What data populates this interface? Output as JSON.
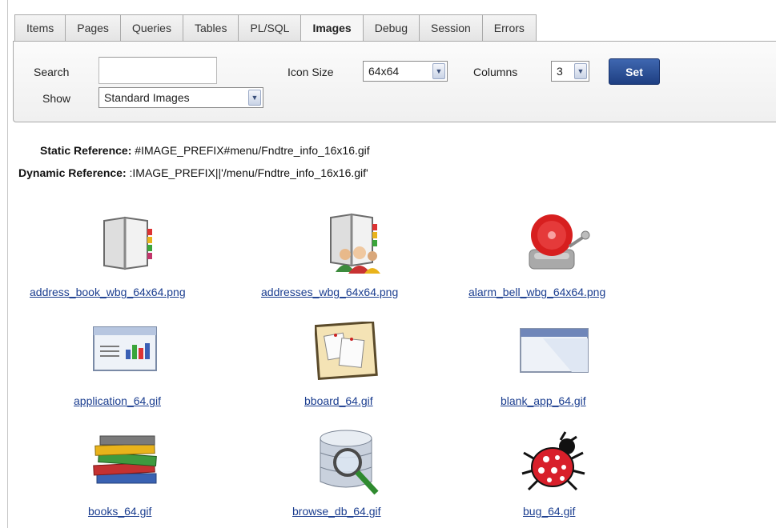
{
  "tabs": [
    {
      "label": "Items"
    },
    {
      "label": "Pages"
    },
    {
      "label": "Queries"
    },
    {
      "label": "Tables"
    },
    {
      "label": "PL/SQL"
    },
    {
      "label": "Images",
      "active": true
    },
    {
      "label": "Debug"
    },
    {
      "label": "Session"
    },
    {
      "label": "Errors"
    }
  ],
  "filters": {
    "search_label": "Search",
    "search_value": "",
    "show_label": "Show",
    "show_value": "Standard Images",
    "icon_size_label": "Icon Size",
    "icon_size_value": "64x64",
    "columns_label": "Columns",
    "columns_value": "3",
    "set_label": "Set"
  },
  "reference": {
    "static_label": "Static Reference:",
    "static_value": "#IMAGE_PREFIX#menu/Fndtre_info_16x16.gif",
    "dynamic_label": "Dynamic Reference:",
    "dynamic_value": ":IMAGE_PREFIX||'/menu/Fndtre_info_16x16.gif'"
  },
  "images": [
    {
      "name": "address_book_wbg_64x64.png",
      "icon": "address-book-icon"
    },
    {
      "name": "addresses_wbg_64x64.png",
      "icon": "addresses-icon"
    },
    {
      "name": "alarm_bell_wbg_64x64.png",
      "icon": "alarm-bell-icon"
    },
    {
      "name": "application_64.gif",
      "icon": "application-icon"
    },
    {
      "name": "bboard_64.gif",
      "icon": "bboard-icon"
    },
    {
      "name": "blank_app_64.gif",
      "icon": "blank-app-icon"
    },
    {
      "name": "books_64.gif",
      "icon": "books-icon"
    },
    {
      "name": "browse_db_64.gif",
      "icon": "browse-db-icon"
    },
    {
      "name": "bug_64.gif",
      "icon": "bug-icon"
    }
  ]
}
